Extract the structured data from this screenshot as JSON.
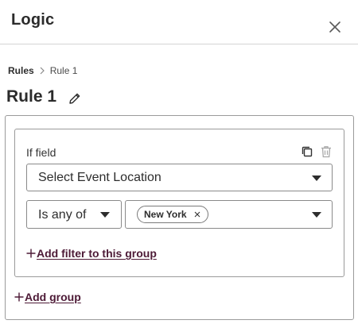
{
  "panel": {
    "title": "Logic"
  },
  "breadcrumb": {
    "root": "Rules",
    "current": "Rule 1"
  },
  "rule": {
    "title": "Rule 1"
  },
  "group": {
    "if_label": "If field",
    "field_select": {
      "value": "Select Event Location"
    },
    "operator_select": {
      "value": "Is any of"
    },
    "values": [
      {
        "label": "New York"
      }
    ],
    "add_filter_label": "Add filter to this group"
  },
  "add_group_label": "Add group",
  "colors": {
    "link": "#4d1a36",
    "border": "#9a9a9a",
    "text": "#2d2d2d"
  },
  "icons": {
    "close": "close-icon",
    "edit": "pencil-icon",
    "copy": "copy-icon",
    "delete": "trash-icon",
    "dropdown": "caret-down-icon",
    "chip_remove": "x-icon",
    "add": "plus-icon",
    "breadcrumb_separator": "chevron-right-icon"
  }
}
